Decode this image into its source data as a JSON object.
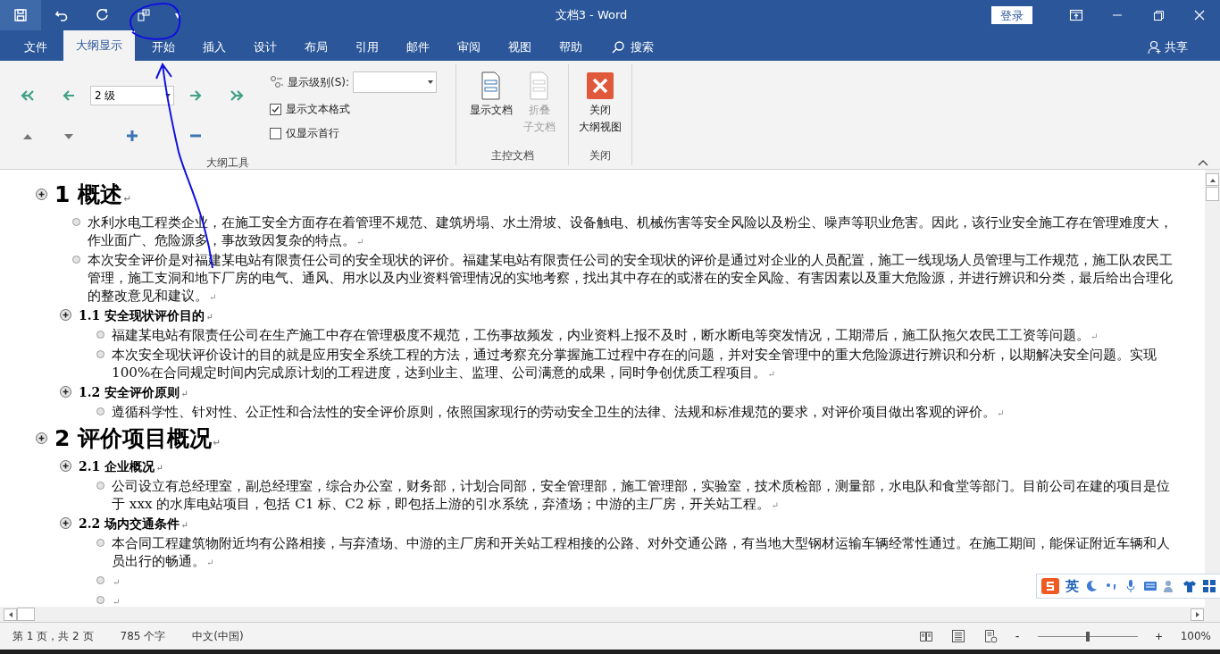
{
  "quick_access": {
    "customize": "▾"
  },
  "window": {
    "title": "文档3  -  Word",
    "sign_in": "登录"
  },
  "tabs": [
    {
      "label": "文件",
      "selected": false
    },
    {
      "label": "大纲显示",
      "selected": true
    },
    {
      "label": "开始",
      "selected": false
    },
    {
      "label": "插入",
      "selected": false
    },
    {
      "label": "设计",
      "selected": false
    },
    {
      "label": "布局",
      "selected": false
    },
    {
      "label": "引用",
      "selected": false
    },
    {
      "label": "邮件",
      "selected": false
    },
    {
      "label": "审阅",
      "selected": false
    },
    {
      "label": "视图",
      "selected": false
    },
    {
      "label": "帮助",
      "selected": false
    }
  ],
  "search": {
    "label": "搜索"
  },
  "share": {
    "label": "共享"
  },
  "ribbon": {
    "outline_tools": {
      "level": "2 级",
      "show_level_label": "显示级别(S):",
      "checkboxes": [
        {
          "label": "显示文本格式",
          "checked": true
        },
        {
          "label": "仅显示首行",
          "checked": false
        }
      ],
      "group_label": "大纲工具"
    },
    "master_document": {
      "buttons": [
        {
          "lines": [
            "显示文档"
          ],
          "disabled": false
        },
        {
          "lines": [
            "折叠",
            "子文档"
          ],
          "disabled": true
        }
      ],
      "group_label": "主控文档"
    },
    "close": {
      "lines": [
        "关闭",
        "大纲视图"
      ],
      "group_label": "关闭"
    }
  },
  "document": {
    "outline": [
      {
        "kind": "heading",
        "number": "1",
        "text": "概述",
        "mark": "↵",
        "children": [
          {
            "kind": "body",
            "text": "水利水电工程类企业，在施工安全方面存在着管理不规范、建筑坍塌、水土滑坡、设备触电、机械伤害等安全风险以及粉尘、噪声等职业危害。因此，该行业安全施工存在管理难度大，作业面广、危险源多，事故致因复杂的特点。",
            "mark": "↵"
          },
          {
            "kind": "body",
            "text": "本次安全评价是对福建某电站有限责任公司的安全现状的评价。福建某电站有限责任公司的安全现状的评价是通过对企业的人员配置，施工一线现场人员管理与工作规范，施工队农民工管理，施工支洞和地下厂房的电气、通风、用水以及内业资料管理情况的实地考察，找出其中存在的或潜在的安全风险、有害因素以及重大危险源，并进行辨识和分类，最后给出合理化的整改意见和建议。",
            "mark": "↵"
          },
          {
            "kind": "heading",
            "number": "1.1",
            "text": "安全现状评价目的",
            "mark": "↵",
            "children": [
              {
                "kind": "body",
                "text": "福建某电站有限责任公司在生产施工中存在管理极度不规范，工伤事故频发，内业资料上报不及时，断水断电等突发情况，工期滞后，施工队拖欠农民工工资等问题。",
                "mark": "↵"
              },
              {
                "kind": "body",
                "text": "本次安全现状评价设计的目的就是应用安全系统工程的方法，通过考察充分掌握施工过程中存在的问题，并对安全管理中的重大危险源进行辨识和分析，以期解决安全问题。实现 100%在合同规定时间内完成原计划的工程进度，达到业主、监理、公司满意的成果，同时争创优质工程项目。",
                "mark": "↵"
              }
            ]
          },
          {
            "kind": "heading",
            "number": "1.2",
            "text": "安全评价原则",
            "mark": "↵",
            "children": [
              {
                "kind": "body",
                "text": "遵循科学性、针对性、公正性和合法性的安全评价原则，依照国家现行的劳动安全卫生的法律、法规和标准规范的要求，对评价项目做出客观的评价。",
                "mark": "↵"
              }
            ]
          }
        ]
      },
      {
        "kind": "heading",
        "number": "2",
        "text": "评价项目概况",
        "mark": "↵",
        "children": [
          {
            "kind": "heading",
            "number": "2.1",
            "text": "企业概况",
            "mark": "↵",
            "children": [
              {
                "kind": "body",
                "text": "公司设立有总经理室，副总经理室，综合办公室，财务部，计划合同部，安全管理部，施工管理部，实验室，技术质检部，测量部，水电队和食堂等部门。目前公司在建的项目是位于 xxx 的水库电站项目，包括 C1 标、C2 标，即包括上游的引水系统，弃渣场；中游的主厂房，开关站工程。",
                "mark": "↵"
              }
            ]
          },
          {
            "kind": "heading",
            "number": "2.2",
            "text": "场内交通条件",
            "mark": "↵",
            "children": [
              {
                "kind": "body",
                "text": "本合同工程建筑物附近均有公路相接，与弃渣场、中游的主厂房和开关站工程相接的公路、对外交通公路，有当地大型钢材运输车辆经常性通过。在施工期间，能保证附近车辆和人员出行的畅通。",
                "mark": "↵"
              },
              {
                "kind": "body",
                "mark": "↵"
              },
              {
                "kind": "body",
                "mark": "↵"
              }
            ]
          }
        ]
      }
    ]
  },
  "ime_toolbar": {
    "mode": "英"
  },
  "status_bar": {
    "page": "第 1 页，共 2 页",
    "words": "785 个字",
    "language": "中文(中国)",
    "zoom_minus": "-",
    "zoom_plus": "+",
    "zoom": {
      "level": 0.5
    },
    "zoom_label": "100%"
  }
}
